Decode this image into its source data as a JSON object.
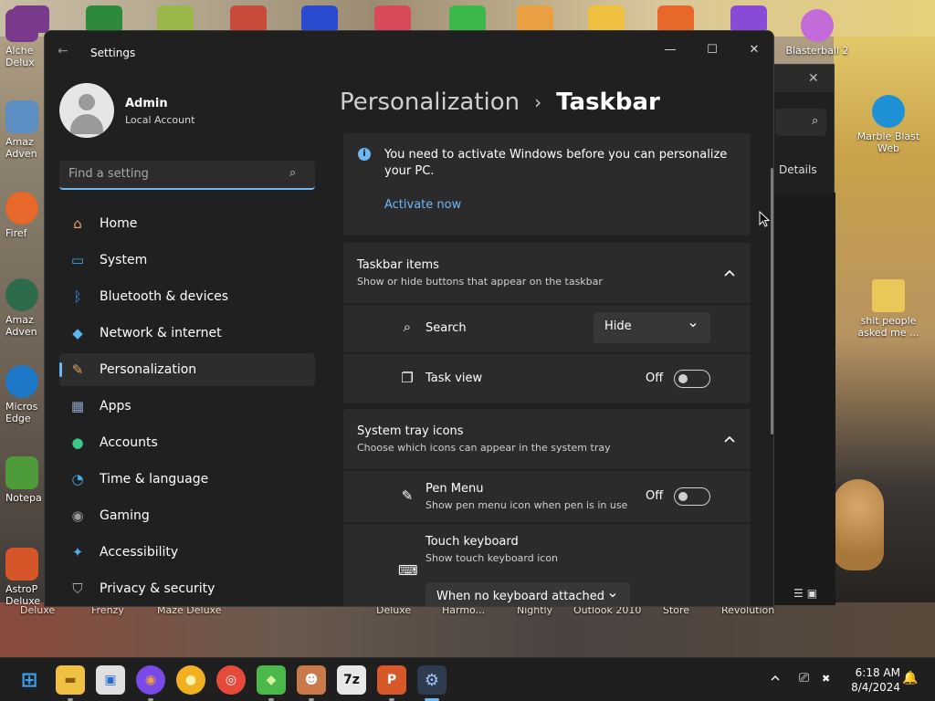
{
  "desktop": {
    "right_icons": [
      {
        "label": "Blasterball 2",
        "color": "#c36bd8"
      },
      {
        "label": "Marble Blast Web",
        "color": "#1e90d6"
      },
      {
        "label": "shit people asked me ...",
        "color": "#e9c85a"
      }
    ],
    "left_icons": [
      {
        "label": "Alche Delux",
        "color": "#7a3a8c"
      },
      {
        "label": "Amaz Adven",
        "color": "#5c8ec4"
      },
      {
        "label": "Firef",
        "color": "#e8682a"
      },
      {
        "label": "Amaz Adven",
        "color": "#2d6b4a"
      },
      {
        "label": "Micros Edge",
        "color": "#1e78c8"
      },
      {
        "label": "Notepa",
        "color": "#4f9a3a"
      },
      {
        "label": "AstroP Deluxe",
        "color": "#d6562a"
      }
    ],
    "bottom_labels": [
      "Deluxe",
      "Frenzy",
      "Maze Deluxe",
      "Deluxe",
      "Harmo...",
      "Nightly",
      "Outlook 2010",
      "Store",
      "Revolution"
    ]
  },
  "background_window": {
    "close_glyph": "✕",
    "search_glyph": "⌕",
    "details_label": "Details",
    "view_glyphs": "☰▣",
    "partial_text": "ll 2 s"
  },
  "settings": {
    "title": "Settings",
    "back_glyph": "←",
    "minimize_glyph": "—",
    "maximize_glyph": "☐",
    "close_glyph": "✕",
    "profile": {
      "name": "Admin",
      "account": "Local Account"
    },
    "search": {
      "placeholder": "Find a setting",
      "icon": "⌕"
    },
    "nav": [
      {
        "label": "Home",
        "icon": "home-icon",
        "glyph": "⌂",
        "color": "#f0a36c"
      },
      {
        "label": "System",
        "icon": "system-icon",
        "glyph": "▭",
        "color": "#3aa8e8"
      },
      {
        "label": "Bluetooth & devices",
        "icon": "bluetooth-icon",
        "glyph": "ᛒ",
        "color": "#3a8ee8"
      },
      {
        "label": "Network & internet",
        "icon": "wifi-icon",
        "glyph": "◆",
        "color": "#5ab8f0"
      },
      {
        "label": "Personalization",
        "icon": "brush-icon",
        "glyph": "✎",
        "color": "#e8a25a"
      },
      {
        "label": "Apps",
        "icon": "apps-icon",
        "glyph": "▦",
        "color": "#8ea2c8"
      },
      {
        "label": "Accounts",
        "icon": "accounts-icon",
        "glyph": "●",
        "color": "#3ec78a"
      },
      {
        "label": "Time & language",
        "icon": "clock-globe-icon",
        "glyph": "◔",
        "color": "#4aa8e8"
      },
      {
        "label": "Gaming",
        "icon": "gamepad-icon",
        "glyph": "◉",
        "color": "#9a9a9a"
      },
      {
        "label": "Accessibility",
        "icon": "accessibility-icon",
        "glyph": "✦",
        "color": "#4ab0e8"
      },
      {
        "label": "Privacy & security",
        "icon": "shield-icon",
        "glyph": "⛉",
        "color": "#b0b0b0"
      }
    ],
    "active_nav_index": 4,
    "breadcrumb": {
      "parent": "Personalization",
      "separator": "›",
      "current": "Taskbar"
    },
    "notice": {
      "icon_glyph": "i",
      "text": "You need to activate Windows before you can personalize your PC.",
      "link": "Activate now"
    },
    "taskbar_items": {
      "title": "Taskbar items",
      "subtitle": "Show or hide buttons that appear on the taskbar",
      "rows": [
        {
          "label": "Search",
          "icon_glyph": "⌕",
          "control": "dropdown",
          "value": "Hide"
        },
        {
          "label": "Task view",
          "icon_glyph": "❐",
          "control": "toggle",
          "state": "Off"
        }
      ]
    },
    "system_tray_icons": {
      "title": "System tray icons",
      "subtitle": "Choose which icons can appear in the system tray",
      "rows": [
        {
          "label": "Pen Menu",
          "sub": "Show pen menu icon when pen is in use",
          "icon_glyph": "✎",
          "control": "toggle",
          "state": "Off"
        },
        {
          "label": "Touch keyboard",
          "sub": "Show touch keyboard icon",
          "icon_glyph": "⌨",
          "control": "dropdown",
          "value": "When no keyboard attached"
        }
      ]
    }
  },
  "taskbar": {
    "apps": [
      {
        "name": "start-button",
        "color": "#3aa0f0",
        "glyph": "⊞"
      },
      {
        "name": "file-explorer",
        "color": "#f0c040",
        "glyph": "▬"
      },
      {
        "name": "microsoft-store",
        "color": "#e0e0e0",
        "glyph": "▣"
      },
      {
        "name": "firefox",
        "color": "#7a4ae8",
        "glyph": "◉"
      },
      {
        "name": "yellow-app",
        "color": "#f0b020",
        "glyph": "●"
      },
      {
        "name": "chrome",
        "color": "#e84a3a",
        "glyph": "◎"
      },
      {
        "name": "green-cube-app",
        "color": "#4ab84a",
        "glyph": "◆"
      },
      {
        "name": "game-app",
        "color": "#c87a4a",
        "glyph": "☻"
      },
      {
        "name": "7zip",
        "color": "#e8e8e8",
        "glyph": "7z"
      },
      {
        "name": "powerpoint",
        "color": "#d8582a",
        "glyph": "P"
      },
      {
        "name": "settings-app",
        "color": "#5a8ad8",
        "glyph": "⚙"
      }
    ],
    "tray": {
      "chevron_glyph": "⌃",
      "network_glyph": "⎚",
      "volume_glyph": "✖",
      "notification_glyph": "🔔"
    },
    "clock": {
      "time": "6:18 AM",
      "date": "8/4/2024"
    }
  }
}
